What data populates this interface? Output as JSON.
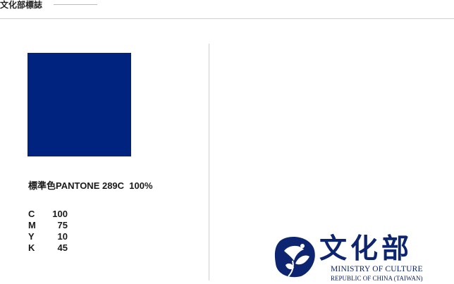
{
  "header": {
    "title": "文化部標誌"
  },
  "color_spec": {
    "swatch_color": "#00237f",
    "label": "標準色PANTONE 289C  100%",
    "cmyk": [
      {
        "letter": "C",
        "value": "100"
      },
      {
        "letter": "M",
        "value": "75"
      },
      {
        "letter": "Y",
        "value": "10"
      },
      {
        "letter": "K",
        "value": "45"
      }
    ]
  },
  "logo": {
    "chinese_name": "文化部",
    "english_line1": "MINISTRY OF CULTURE",
    "english_line2": "REPUBLIC OF CHINA (TAIWAN)",
    "mark_icon": "morning-glory-emblem-icon",
    "brand_color": "#0d2470"
  }
}
